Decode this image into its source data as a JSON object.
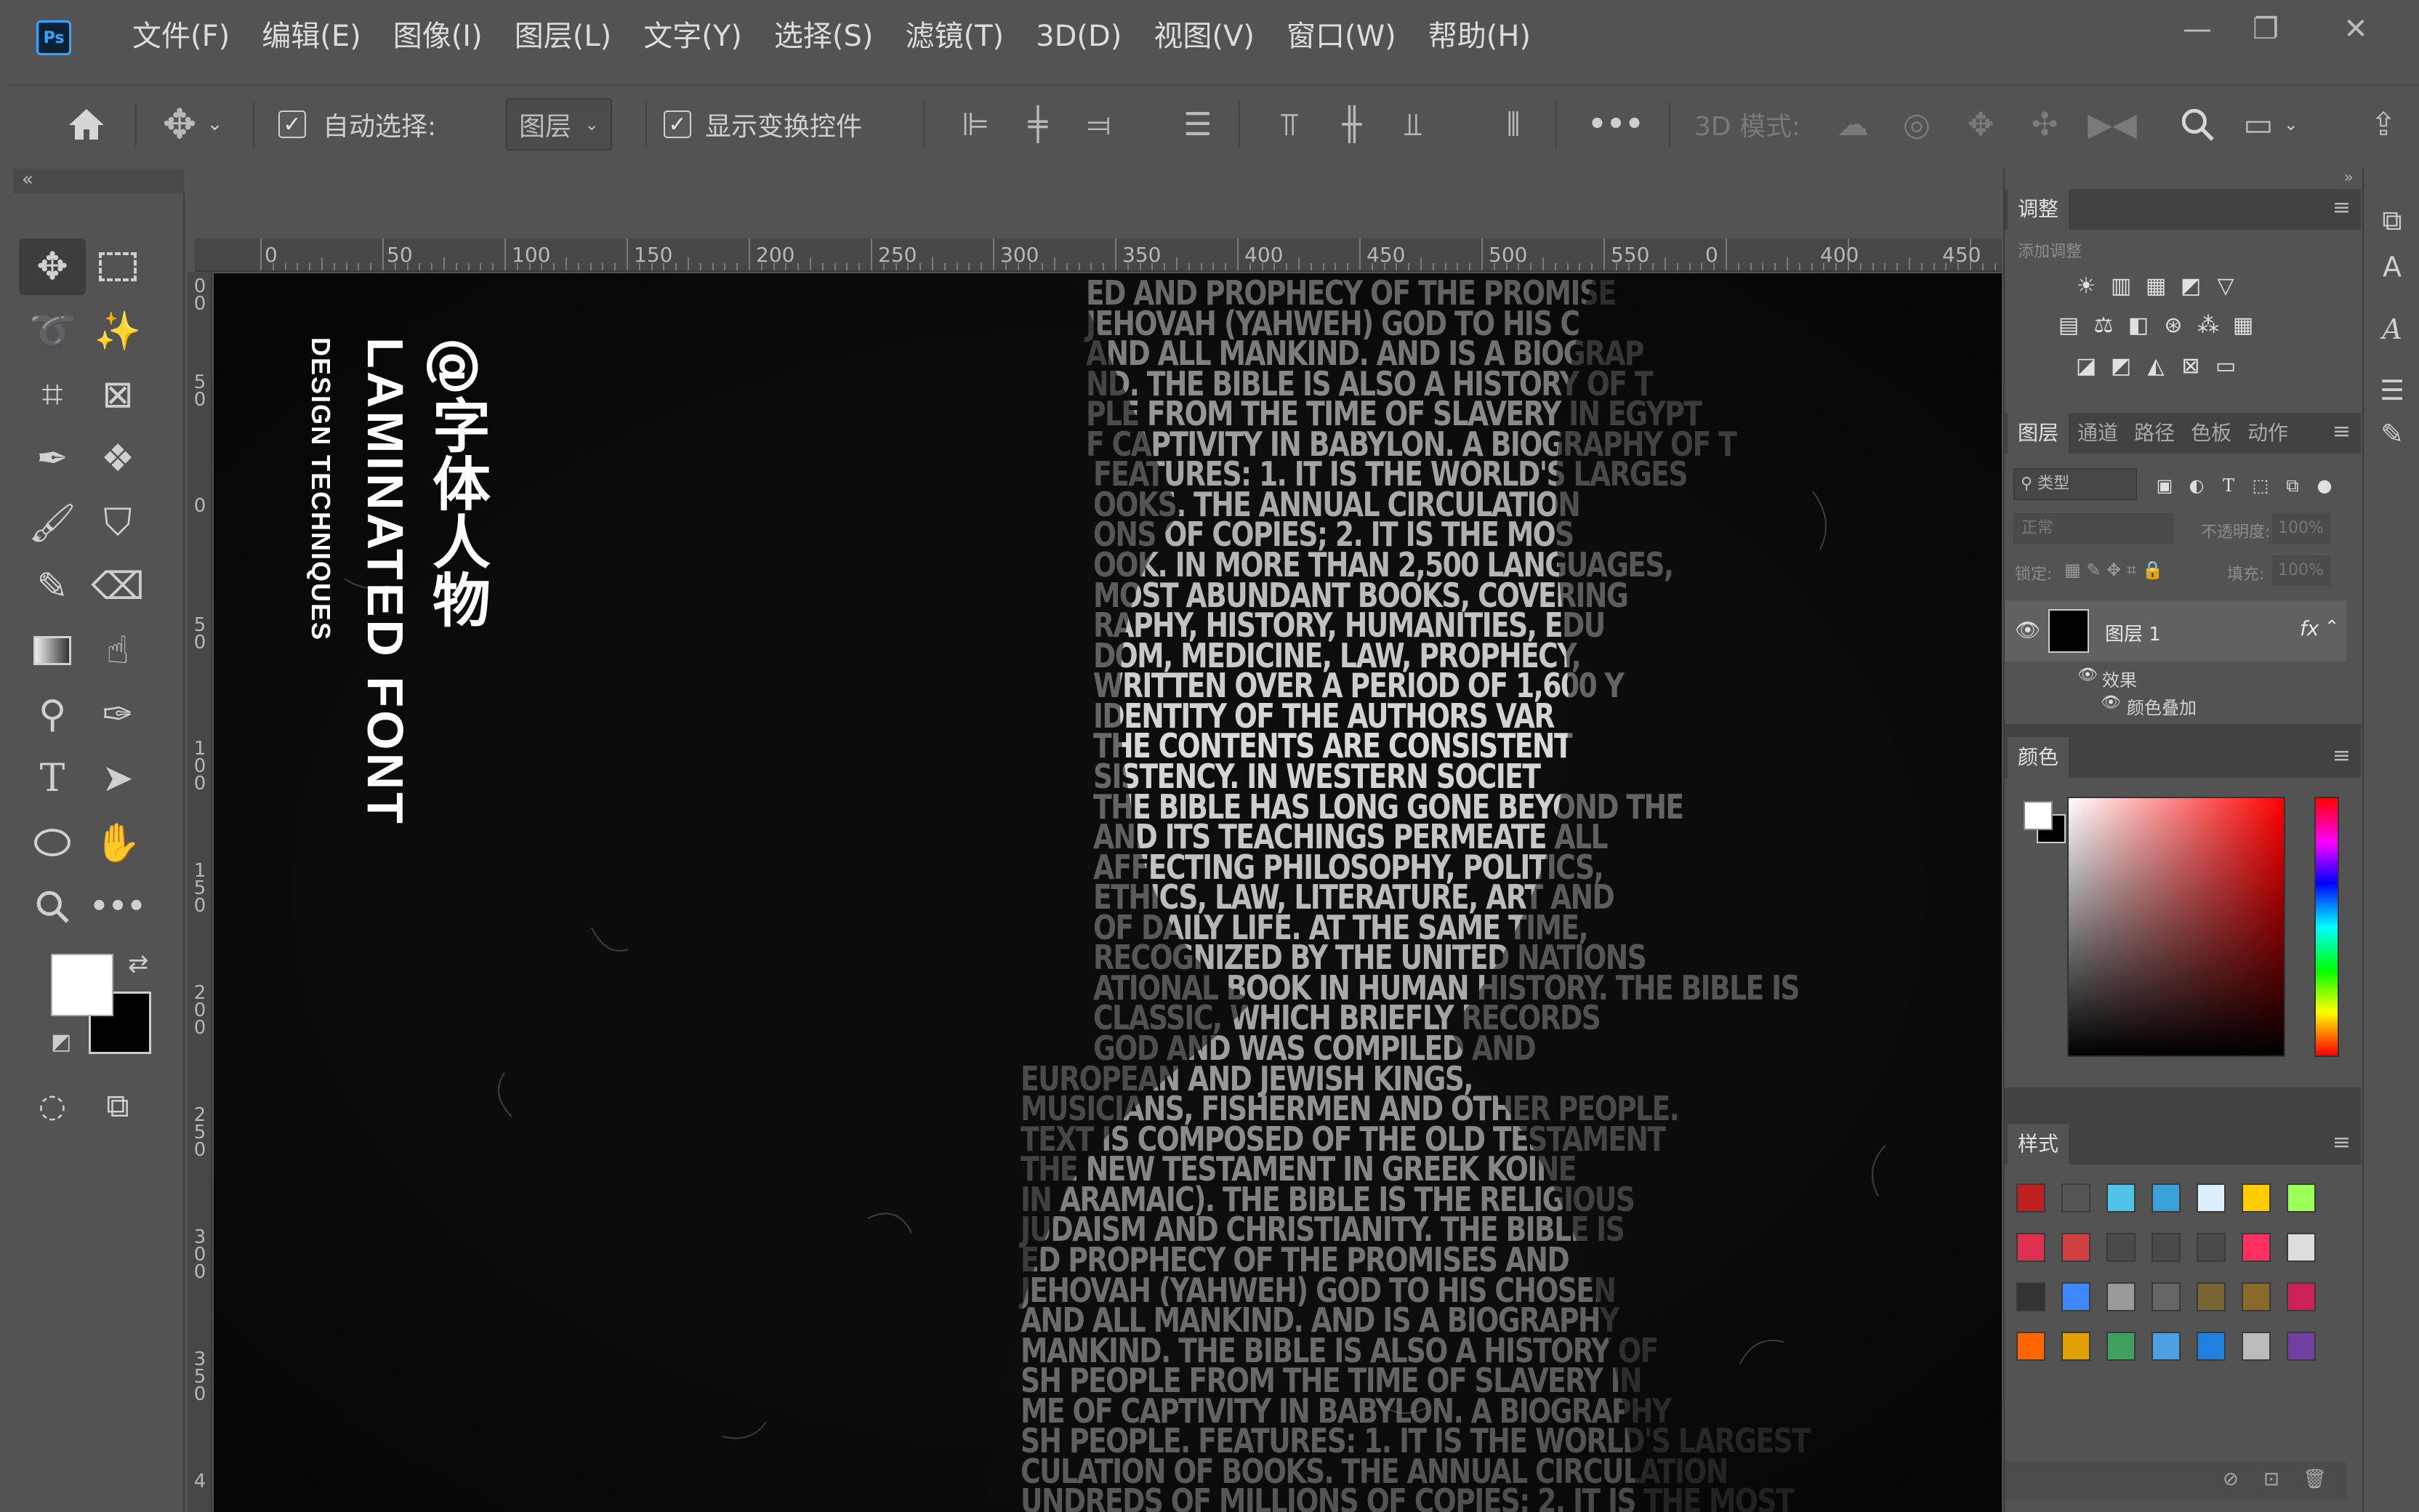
{
  "app": {
    "logo_text": "Ps"
  },
  "menu": [
    "文件(F)",
    "编辑(E)",
    "图像(I)",
    "图层(L)",
    "文字(Y)",
    "选择(S)",
    "滤镜(T)",
    "3D(D)",
    "视图(V)",
    "窗口(W)",
    "帮助(H)"
  ],
  "window_controls": {
    "minimize": "—",
    "maximize": "❐",
    "close": "✕"
  },
  "options_bar": {
    "auto_select_label": "自动选择:",
    "auto_select_value": "图层",
    "show_transform_label": "显示变换控件",
    "more": "•••",
    "mode_3d_label": "3D 模式:"
  },
  "ruler_h_labels": [
    "0",
    "50",
    "100",
    "150",
    "200",
    "250",
    "300",
    "350",
    "400",
    "450",
    "500",
    "550",
    "0",
    "400",
    "450"
  ],
  "ruler_v_labels": [
    "0 0",
    "5 0",
    "0",
    "5 0",
    "1 0 0",
    "1 5 0",
    "2 0 0",
    "2 5 0",
    "3 0 0",
    "3 5 0",
    "4"
  ],
  "canvas": {
    "title_cn": "@字体人物",
    "title_en": "LAMINATED FONT",
    "title_sub": "DESIGN TECHNIQUES",
    "text_lines": [
      "ED AND PROPHECY OF THE PROMISE",
      "JEHOVAH (YAHWEH) GOD TO HIS C",
      "AND ALL MANKIND. AND IS A BIOGRAP",
      "ND. THE BIBLE IS ALSO A HISTORY OF T",
      "PLE FROM THE TIME OF SLAVERY IN EGYPT",
      "F CAPTIVITY IN BABYLON. A BIOGRAPHY OF T",
      "FEATURES: 1. IT IS THE WORLD'S LARGES",
      "OOKS. THE ANNUAL CIRCULATION",
      "ONS OF COPIES; 2. IT IS THE MOS",
      "OOK. IN MORE THAN 2,500 LANGUAGES,",
      "MOST ABUNDANT BOOKS, COVERING",
      "RAPHY, HISTORY, HUMANITIES, EDU",
      "DOM, MEDICINE, LAW, PROPHECY,",
      "WRITTEN OVER A PERIOD OF 1,600 Y",
      "IDENTITY OF THE AUTHORS VAR",
      "THE CONTENTS ARE CONSISTENT",
      "SISTENCY. IN WESTERN SOCIET",
      "THE BIBLE HAS LONG GONE BEYOND THE",
      "AND ITS TEACHINGS PERMEATE ALL",
      "AFFECTING PHILOSOPHY, POLITICS,",
      "ETHICS, LAW, LITERATURE, ART AND",
      "OF DAILY LIFE. AT THE SAME TIME,",
      "RECOGNIZED BY THE UNITED NATIONS",
      "ATIONAL BOOK IN HUMAN HISTORY. THE BIBLE IS",
      "CLASSIC, WHICH BRIEFLY RECORDS",
      "GOD AND WAS COMPILED AND",
      "EUROPEAN AND JEWISH KINGS,",
      "MUSICIANS, FISHERMEN AND OTHER PEOPLE.",
      "TEXT IS COMPOSED OF THE OLD TESTAMENT",
      "THE NEW TESTAMENT IN GREEK KOINE",
      "IN ARAMAIC). THE BIBLE IS THE RELIGIOUS",
      "JUDAISM AND CHRISTIANITY. THE BIBLE IS",
      "ED PROPHECY OF THE PROMISES AND",
      "JEHOVAH (YAHWEH) GOD TO HIS CHOSEN",
      "AND ALL MANKIND. AND IS A BIOGRAPHY",
      "MANKIND. THE BIBLE IS ALSO A HISTORY OF",
      "SH PEOPLE FROM THE TIME OF SLAVERY IN",
      "ME OF CAPTIVITY IN BABYLON. A BIOGRAPHY",
      "SH PEOPLE. FEATURES: 1. IT IS THE WORLD'S LARGEST",
      "CULATION OF BOOKS. THE ANNUAL CIRCULATION",
      "UNDREDS OF MILLIONS OF COPIES; 2. IT IS THE MOST"
    ]
  },
  "panels": {
    "adjustments": {
      "tab": "调整",
      "subtitle": "添加调整"
    },
    "layers": {
      "tabs": [
        "图层",
        "通道",
        "路径",
        "色板",
        "动作"
      ],
      "filter_kind": "类型",
      "blend_mode": "正常",
      "opacity_label": "不透明度:",
      "opacity_value": "100%",
      "lock_label": "锁定:",
      "fill_label": "填充:",
      "fill_value": "100%",
      "layer_name": "图层 1",
      "fx": "fx",
      "effects_label": "效果",
      "effect_item": "颜色叠加"
    },
    "color": {
      "tab": "颜色",
      "fg_color": "#ffffff",
      "bg_color": "#000000"
    },
    "styles": {
      "tab": "样式"
    }
  }
}
